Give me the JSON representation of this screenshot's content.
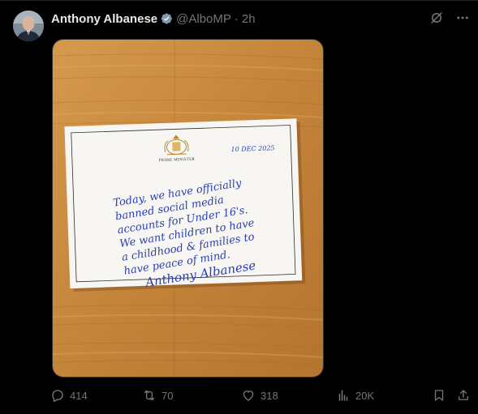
{
  "post": {
    "author_name": "Anthony Albanese",
    "handle": "@AlboMP",
    "separator": "·",
    "time": "2h",
    "verified": true
  },
  "note": {
    "letterhead": "PRIME MINISTER",
    "date": "10 DEC 2025",
    "lines": [
      "Today, we have officially",
      "banned social media",
      "accounts for Under 16's.",
      "We want children to have",
      "a childhood & families to",
      "have peace of mind."
    ],
    "signature": "Anthony Albanese"
  },
  "metrics": {
    "replies": "414",
    "reposts": "70",
    "likes": "318",
    "views": "20K"
  },
  "colors": {
    "background": "#000000",
    "text_primary": "#e7e9ea",
    "text_secondary": "#71767b",
    "verified_badge": "#829aab",
    "ink": "#2a3fb0",
    "wood": "#c98a3e"
  },
  "icons": {
    "verified": "verified-badge-icon",
    "grok": "grok-icon",
    "more": "more-icon",
    "reply": "reply-icon",
    "repost": "repost-icon",
    "like": "like-icon",
    "views": "views-icon",
    "bookmark": "bookmark-icon",
    "share": "share-icon"
  }
}
